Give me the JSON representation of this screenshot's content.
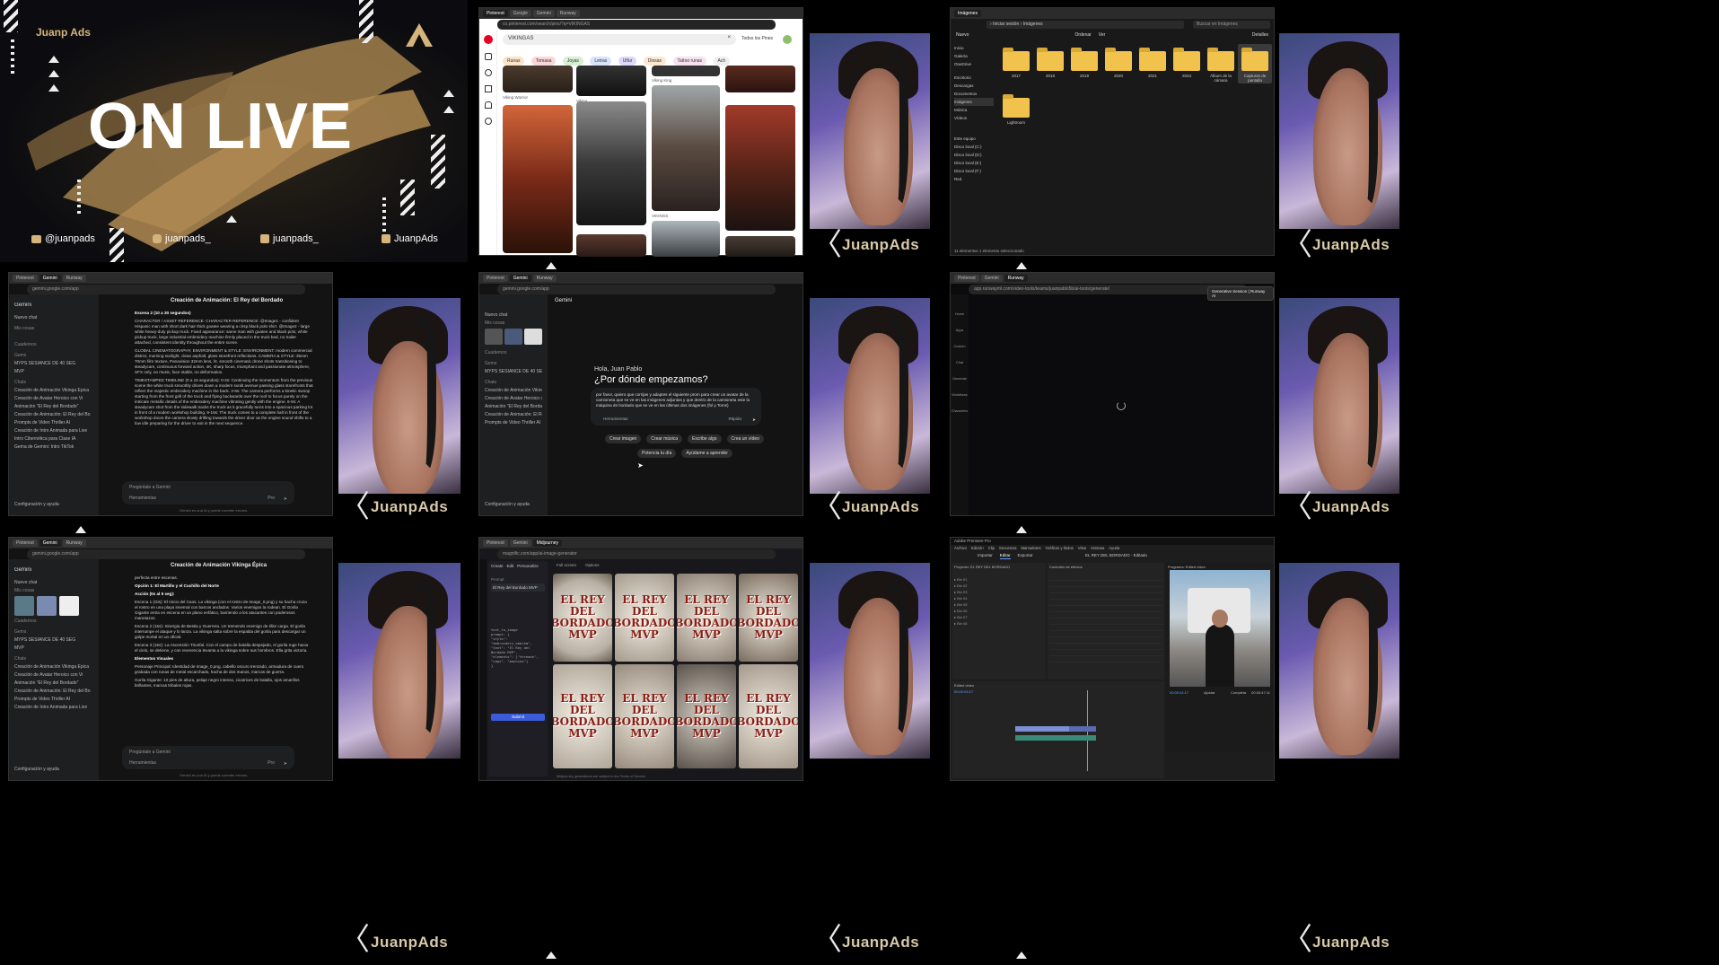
{
  "live": {
    "logo_left": "Juanp Ads",
    "title": "ON LIVE",
    "socials": [
      "@juanpads",
      "juanpads_",
      "juanpads_",
      "JuanpAds"
    ]
  },
  "brand": "JuanpAds",
  "pinterest": {
    "search": "VIKINGAS",
    "filter": "Todos los Pines",
    "chips": [
      "Runas",
      "Tomasa",
      "Joyas",
      "Letras",
      "Ulfur",
      "Diosas",
      "Tattoo runas",
      "Ach"
    ],
    "captions": [
      "Viking Warrior",
      "Viking",
      "Viking King",
      "VIKINGS"
    ]
  },
  "explorer": {
    "title": "Imágenes",
    "search_placeholder": "Buscar en Imágenes",
    "new_button": "Nuevo",
    "sort_button": "Ordenar",
    "view_button": "Ver",
    "details_button": "Detalles",
    "nav": [
      "Inicio",
      "Galería",
      "OneDrive",
      "Escritorio",
      "Descargas",
      "Documentos",
      "Imágenes",
      "Música",
      "Vídeos",
      "Este equipo",
      "Disco local (C:)",
      "Disco local (D:)",
      "Disco local (E:)",
      "Disco local (F:)",
      "Red"
    ],
    "folders": [
      "2017",
      "2018",
      "2019",
      "2020",
      "2021",
      "2023",
      "Álbum de la cámara",
      "Capturas de pantalla",
      "Fotos en iCloud",
      "Imágenes guardadas",
      "Lightroom"
    ],
    "status": "11 elementos   1 elemento seleccionado"
  },
  "gemini1": {
    "app": "Gemini",
    "chat_title": "Creación de Animación: El Rey del Bordado",
    "new_chat": "Nuevo chat",
    "sections": [
      "Mis cosas",
      "Cuadernos",
      "Gems",
      "Chats"
    ],
    "gems": [
      "MYPS SESIANCE DE 40 SEG",
      "MVP"
    ],
    "chats": [
      "Creación de Animación Vikinga Épica",
      "Creación de Avatar Heroico con Vi",
      "Animación \"El Rey del Bordado\"",
      "Creación de Animación: El Rey del Bo",
      "Prompts de Video Thriller AI",
      "Creación de Intro Animada para Live",
      "Intro Cibernética para Clase IA",
      "Gema de Gemini: Intro TikTok"
    ],
    "scene_heading": "Escena 2 (10 a 30 segundos)",
    "items": [
      "CHARACTER / ASSET REFERENCE: CHARACTER REFERENCE: @Image1 - confident Hispanic man with short dark hair thick goatee wearing a crisp black polo shirt. @Image2 - large white heavy-duty pickup truck. Fixed appearance: same man with goatee and black polo, white pickup truck, large industrial embroidery machine firmly placed in the truck bed, no trailer attached, consistent identity throughout the entire scene.",
      "GLOBAL CINEMATOGRAPHY, ENVIRONMENT & STYLE: ENVIRONMENT: modern commercial district, morning sunlight, clean asphalt, glass storefront reflections. CAMERA & STYLE: 35mm 70mm film texture, Panavision 32mm lens, f4, smooth cinematic drone shots transitioning to steadycam, continuous forward action, 4K, sharp focus, triumphant and passionate atmosphere, SFX only, no music, face stable, no deformation.",
      "TIMESTAMPED TIMELINE (0 a 15 segundos): 0-3s: Continuing the momentum from the previous scene the white truck smoothly drives down a modern sunlit avenue passing glass storefronts that reflect the majestic embroidery machine in the back. 3-6s: The camera performs a kinetic swoop starting from the front grill of the truck and flying backwards over the roof to focus purely on the intricate metallic details of the embroidery machine vibrating gently with the engine. 6-9s: A steadycam shot from the sidewalk tracks the truck as it gracefully turns into a spacious parking lot in front of a modern workshop building. 9-15s: The truck comes to a complete halt in front of the workshop doors the camera slowly drifting towards the driver door as the engine sound shifts to a low idle preparing for the driver to exit in the next sequence."
    ],
    "input_placeholder": "Pregúntale a Gemini",
    "tools": "Herramientas",
    "mode": "Pro",
    "settings": "Configuración y ayuda",
    "disclaimer": "Gemini es una IA y puede cometer errores."
  },
  "gemini2": {
    "greeting": "Hola, Juan Pablo",
    "question": "¿Por dónde empezamos?",
    "prompt": "por favor, quiero que corrijas y adaptes el siguiente prom para crear un avatar de la camioneta que se ve en las imágenes adjuntas y que dentro de la camioneta este la máquina de bordado que se ve en las últimas dos imágenes (fol y Toms)",
    "model": "Rápido",
    "actions": [
      "Crear imagen",
      "Crear música",
      "Escribe algo",
      "Crea un vídeo",
      "Potencia tu día",
      "Ayúdame a aprender"
    ]
  },
  "runway": {
    "url": "app.runwayml.com/video-tools/teams/juanpablo5b/ai-tools/generate/",
    "tooltip": "Generative Session | Runway AI",
    "rail": [
      "Home",
      "Apps",
      "Custom",
      "Chat",
      "Generate",
      "Workflows",
      "Characters"
    ]
  },
  "gemini3": {
    "chat_title": "Creación de Animación Vikinga Épica",
    "intro": "perfecta entre escenas.",
    "option_heading": "Opción 1: El Martillo y el Cuchillo del Norte",
    "action_heading": "Acción (0s al 5 seg):",
    "scenes": [
      "Escena 1 (Gis): El Inicio del Caos. La vikinga (con el rostro de Image_0.png) y su hacha cruza el rostro en una playa invernal con barcos anclados. Varios enemigos la rodean. El Gorila Gigante entra en escena en un plano enfático, barriendo a los atacantes con poderosos manotazos.",
      "Escena 2 (15s): Sinergia de Bestia y Guerrera. Un tremendo enemigo de élite carga. El gorila interrumpe el ataque y lo lanza. La vikinga salta sobre la espalda del gorila para descargar un golpe mortal en un oficial.",
      "Escena 3 (15s): La Ascensión Triunfal. Con el campo de batalla despejado, el gorila ruge hacia el cielo, se detiene, y con reverencia levanta a la vikinga sobre sus hombros. Ella grita victoria."
    ],
    "visual_heading": "Elementos Visuales",
    "visuals": [
      "Personaje Principal: Identidad de Image_0.png, cabello oscuro trenzado, armadura de cuero grabada con runas de metal escarchado, hacha de dos manos, marcas de guerra.",
      "Gorila Gigante: 10 pies de altura, pelaje negro intenso, cicatrices de batalla, ojos amarillos brillantes, marcas tribales rojas."
    ],
    "input_placeholder": "Pregúntale a Gemini"
  },
  "midjourney": {
    "tabs": [
      "Create",
      "Edit",
      "Personalize"
    ],
    "toolbar": [
      "Full screen",
      "Options"
    ],
    "prompt_label": "Prompt",
    "prompt_text": "El Rey del Bordado MVP",
    "code_lines": [
      "text_to_image",
      "prompt: {",
      "\"style\": \"embroidery_emblem\",",
      "\"text\": \"El Rey del Bordado MVP\",",
      "\"elements\": [\"threads\", \"caps\", \"machine\"]",
      "}"
    ],
    "submit": "Submit",
    "footer": "Midjourney generations are subject to the Terms of Service",
    "result_text": "EL REY DEL BORDADO MVP"
  },
  "premiere": {
    "title": "Adobe Premiere Pro",
    "project": "EL REY DEL BORDADO - Editado",
    "menus": [
      "Archivo",
      "Edición",
      "Clip",
      "Secuencia",
      "Marcadores",
      "Gráficos y títulos",
      "Vista",
      "Ventana",
      "Ayuda"
    ],
    "tabs": [
      "Importar",
      "Editar",
      "Exportar"
    ],
    "panels": [
      "Proyecto: EL REY DEL BORDADO",
      "Controles de efectos",
      "Programa: Edited video"
    ],
    "timecode_left": "00:00:04:17",
    "timecode_right": "00:00:47:11",
    "fit": "Ajustar",
    "quality": "Completa",
    "sequence": "Edited video"
  }
}
